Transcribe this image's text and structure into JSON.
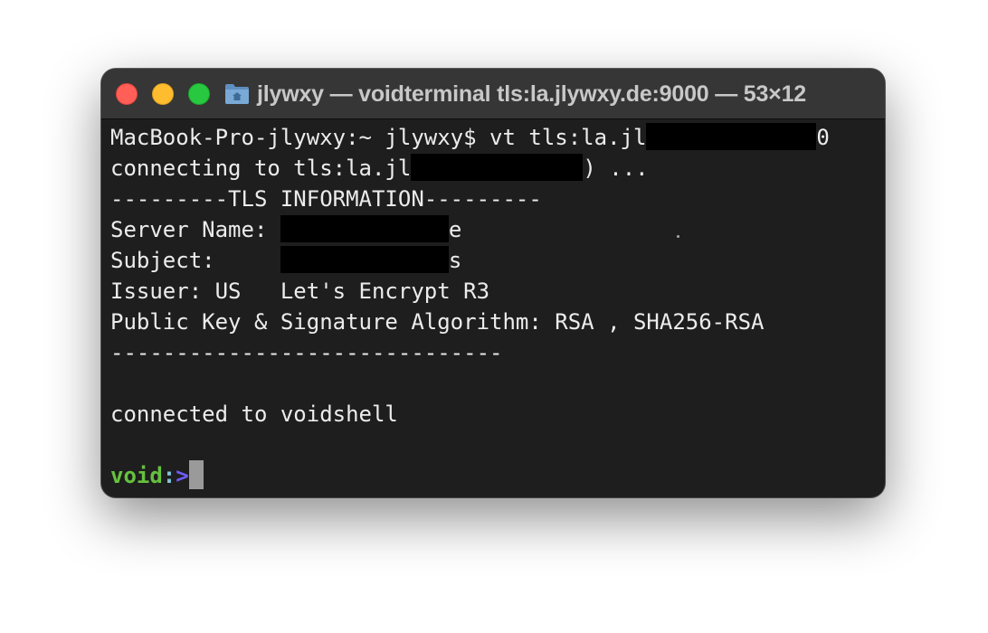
{
  "window": {
    "title": "jlywxy — voidterminal tls:la.jlywxy.de:9000 — 53×12"
  },
  "terminal": {
    "cmd_prompt": "MacBook-Pro-jlywxy:~ jlywxy$ ",
    "cmd_text": "vt tls:la.jl",
    "cmd_tail": "0",
    "connecting_prefix": "connecting to tls:la.jl",
    "connecting_suffix": ") ...",
    "tls_header": "---------TLS INFORMATION---------",
    "server_name_label": "Server Name: ",
    "server_name_tail": "e",
    "subject_label": "Subject:     ",
    "subject_tail": "s",
    "issuer_line": "Issuer: US   Let's Encrypt R3",
    "algorithm_line": "Public Key & Signature Algorithm: RSA , SHA256-RSA",
    "tls_footer": "------------------------------",
    "connected_line": "connected to voidshell",
    "shell_name": "void",
    "shell_colon": ":",
    "shell_arrow": ">"
  },
  "colors": {
    "close": "#ff5f57",
    "minimize": "#febc2e",
    "maximize": "#28c840",
    "prompt_green": "#66c13f",
    "prompt_purple": "#6f5cff"
  }
}
